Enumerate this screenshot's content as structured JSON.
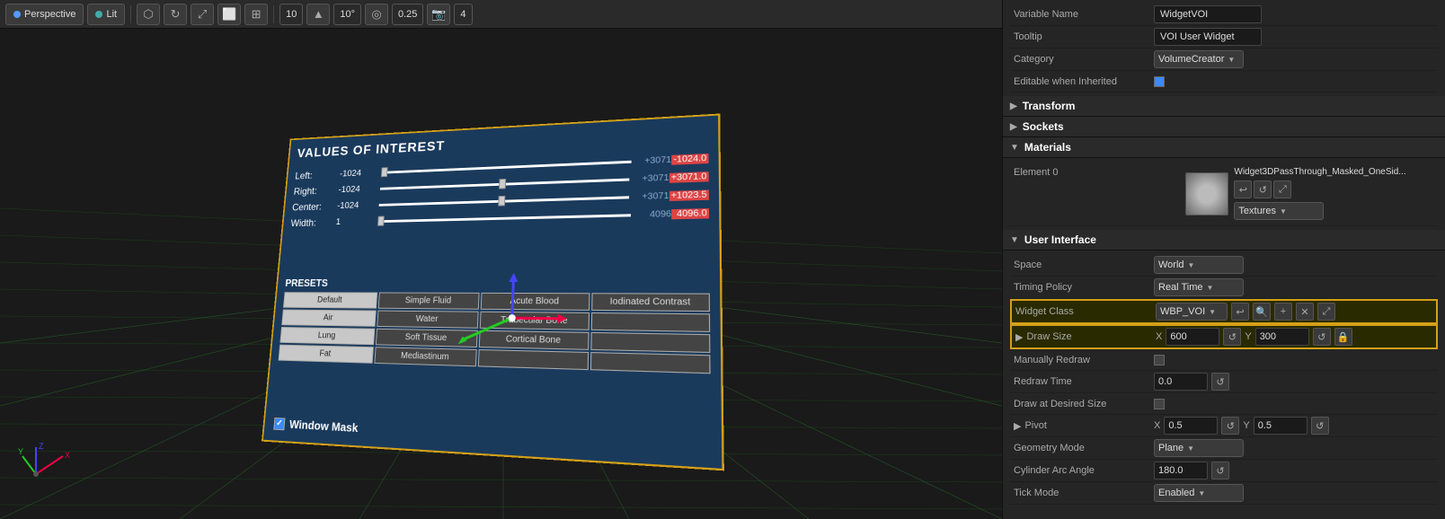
{
  "viewport": {
    "toolbar": {
      "perspective_label": "Perspective",
      "lit_label": "Lit",
      "num1": "10",
      "num2": "10°",
      "num3": "0.25",
      "num4": "4"
    },
    "widget": {
      "title": "VALUES OF INTEREST",
      "sliders": [
        {
          "label": "Left:",
          "value": "-1024",
          "left_end": "+3071",
          "right_end": "-1024.0"
        },
        {
          "label": "Right:",
          "value": "-1024",
          "left_end": "+3071",
          "right_end": "+3071.0"
        },
        {
          "label": "Center:",
          "value": "-1024",
          "left_end": "+3071",
          "right_end": "+1023.5"
        },
        {
          "label": "Width:",
          "value": "1",
          "left_end": "4096",
          "right_end": "4096.0"
        }
      ],
      "presets_title": "PRESETS",
      "presets": [
        [
          "Default",
          "Simple Fluid",
          "Acute Blood",
          "Iodinated Contrast"
        ],
        [
          "Air",
          "Water",
          "Trabecular Bone",
          ""
        ],
        [
          "Lung",
          "Soft Tissue",
          "Cortical Bone",
          ""
        ],
        [
          "Fat",
          "Mediastinum",
          "",
          ""
        ]
      ],
      "window_mask": "Window Mask"
    }
  },
  "right_panel": {
    "variable_name_label": "Variable Name",
    "variable_name_value": "WidgetVOI",
    "tooltip_label": "Tooltip",
    "tooltip_value": "VOI User Widget",
    "category_label": "Category",
    "category_value": "VolumeCreator",
    "editable_inherited_label": "Editable when Inherited",
    "sections": {
      "transform": "Transform",
      "sockets": "Sockets",
      "materials": "Materials",
      "user_interface": "User Interface"
    },
    "materials": {
      "element_label": "Element 0",
      "mat_name": "Widget3DPassThrough_Masked_OneSid...",
      "textures_label": "Textures"
    },
    "user_interface": {
      "space_label": "Space",
      "space_value": "World",
      "timing_label": "Timing Policy",
      "timing_value": "Real Time",
      "widget_class_label": "Widget Class",
      "widget_class_value": "WBP_VOI",
      "draw_size_label": "Draw Size",
      "draw_size_x_label": "X",
      "draw_size_x_value": "600",
      "draw_size_y_label": "Y",
      "draw_size_y_value": "300",
      "manually_redraw_label": "Manually Redraw",
      "redraw_time_label": "Redraw Time",
      "redraw_time_value": "0.0",
      "draw_desired_label": "Draw at Desired Size",
      "pivot_label": "Pivot",
      "pivot_x_label": "X",
      "pivot_x_value": "0.5",
      "pivot_y_label": "Y",
      "pivot_y_value": "0.5",
      "geometry_mode_label": "Geometry Mode",
      "geometry_mode_value": "Plane",
      "cylinder_arc_label": "Cylinder Arc Angle",
      "cylinder_arc_value": "180.0",
      "tick_mode_label": "Tick Mode",
      "tick_mode_value": "Enabled"
    },
    "icons": {
      "arrow_left": "↩",
      "search": "🔍",
      "plus": "+",
      "close": "✕",
      "expand": "⤢",
      "refresh": "↺",
      "lock": "🔒"
    }
  }
}
